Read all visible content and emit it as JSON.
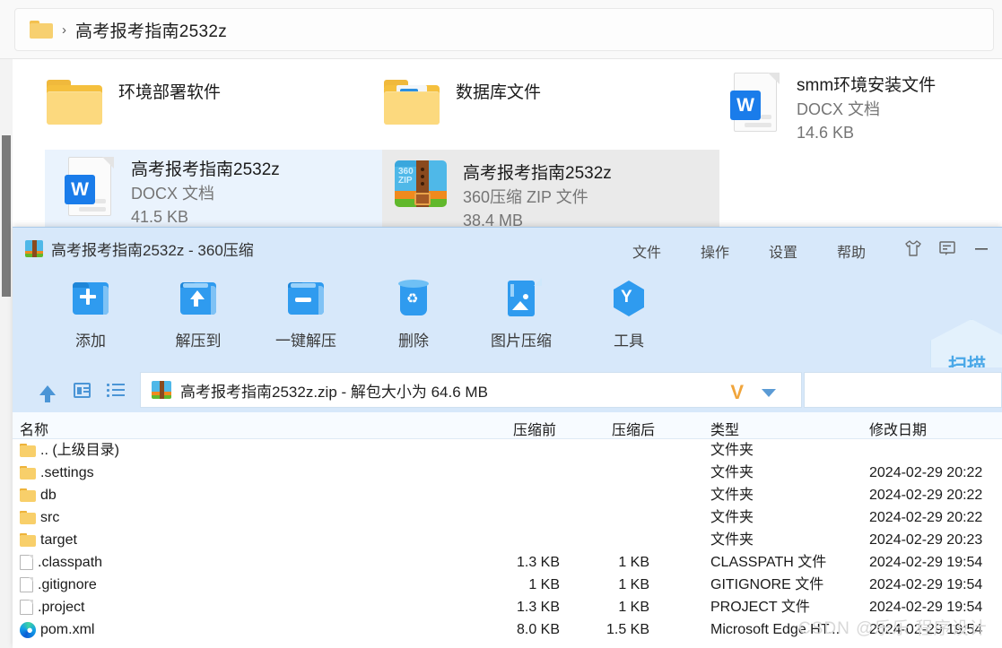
{
  "explorer": {
    "breadcrumb": {
      "folder_icon": "folder-icon",
      "separator": "›",
      "path_label": "高考报考指南2532z"
    },
    "tiles": [
      {
        "name": "环境部署软件",
        "type": "",
        "size": "",
        "icon": "folder-icon",
        "selected": false
      },
      {
        "name": "数据库文件",
        "type": "",
        "size": "",
        "icon": "folder-database-icon",
        "selected": false
      },
      {
        "name": "smm环境安装文件",
        "type": "DOCX 文档",
        "size": "14.6 KB",
        "icon": "word-doc-icon",
        "selected": false
      },
      {
        "name": "高考报考指南2532z",
        "type": "DOCX 文档",
        "size": "41.5 KB",
        "icon": "word-doc-icon",
        "selected": true
      },
      {
        "name": "高考报考指南2532z",
        "type": "360压缩 ZIP 文件",
        "size": "38.4 MB",
        "icon": "zip-360-icon",
        "selected": true
      }
    ]
  },
  "win360": {
    "title": "高考报考指南2532z - 360压缩",
    "title_icon": "zip-360-icon",
    "menus": [
      {
        "label": "文件"
      },
      {
        "label": "操作"
      },
      {
        "label": "设置"
      },
      {
        "label": "帮助"
      }
    ],
    "window_buttons": [
      {
        "name": "skin-tshirt-icon"
      },
      {
        "name": "feedback-icon"
      },
      {
        "name": "minimize-icon"
      }
    ],
    "toolbar": [
      {
        "label": "添加",
        "icon": "folder-add-icon"
      },
      {
        "label": "解压到",
        "icon": "folder-extract-to-icon"
      },
      {
        "label": "一键解压",
        "icon": "folder-one-click-extract-icon"
      },
      {
        "label": "删除",
        "icon": "trash-icon"
      },
      {
        "label": "图片压缩",
        "icon": "image-compress-icon"
      },
      {
        "label": "工具",
        "icon": "tools-hexagon-icon"
      }
    ],
    "scan_badge": {
      "label": "扫描",
      "icon": "shield-scan-icon"
    },
    "pathbar": {
      "up_button": "up-arrow-icon",
      "view_button": "view-panel-icon",
      "list_button": "list-view-icon",
      "archive_icon": "zip-360-icon",
      "value": "高考报考指南2532z.zip - 解包大小为 64.6 MB",
      "dropdown_mark": "V",
      "caret": "chevron-down-icon",
      "search_placeholder": ""
    },
    "list": {
      "columns": [
        "名称",
        "压缩前",
        "压缩后",
        "类型",
        "修改日期"
      ],
      "rows": [
        {
          "name": ".. (上级目录)",
          "icon": "folder-icon",
          "pre": "",
          "post": "",
          "type": "文件夹",
          "date": ""
        },
        {
          "name": ".settings",
          "icon": "folder-icon",
          "pre": "",
          "post": "",
          "type": "文件夹",
          "date": "2024-02-29 20:22"
        },
        {
          "name": "db",
          "icon": "folder-icon",
          "pre": "",
          "post": "",
          "type": "文件夹",
          "date": "2024-02-29 20:22"
        },
        {
          "name": "src",
          "icon": "folder-icon",
          "pre": "",
          "post": "",
          "type": "文件夹",
          "date": "2024-02-29 20:22"
        },
        {
          "name": "target",
          "icon": "folder-icon",
          "pre": "",
          "post": "",
          "type": "文件夹",
          "date": "2024-02-29 20:23"
        },
        {
          "name": ".classpath",
          "icon": "file-icon",
          "pre": "1.3 KB",
          "post": "1 KB",
          "type": "CLASSPATH 文件",
          "date": "2024-02-29 19:54"
        },
        {
          "name": ".gitignore",
          "icon": "file-icon",
          "pre": "1 KB",
          "post": "1 KB",
          "type": "GITIGNORE 文件",
          "date": "2024-02-29 19:54"
        },
        {
          "name": ".project",
          "icon": "file-icon",
          "pre": "1.3 KB",
          "post": "1 KB",
          "type": "PROJECT 文件",
          "date": "2024-02-29 19:54"
        },
        {
          "name": "pom.xml",
          "icon": "edge-browser-icon",
          "pre": "8.0 KB",
          "post": "1.5 KB",
          "type": "Microsoft Edge HT...",
          "date": "2024-02-29 19:54"
        }
      ]
    }
  },
  "watermark": {
    "text": "CSDN @乐乐 程序设计"
  },
  "colors": {
    "accent_blue": "#2f9bef",
    "window_bg": "#d7e8fa",
    "selection": "#eaf3fd",
    "folder_yellow": "#f5c03e",
    "word_blue": "#1a7cea",
    "orange": "#f08a1e",
    "green": "#61b82c"
  }
}
